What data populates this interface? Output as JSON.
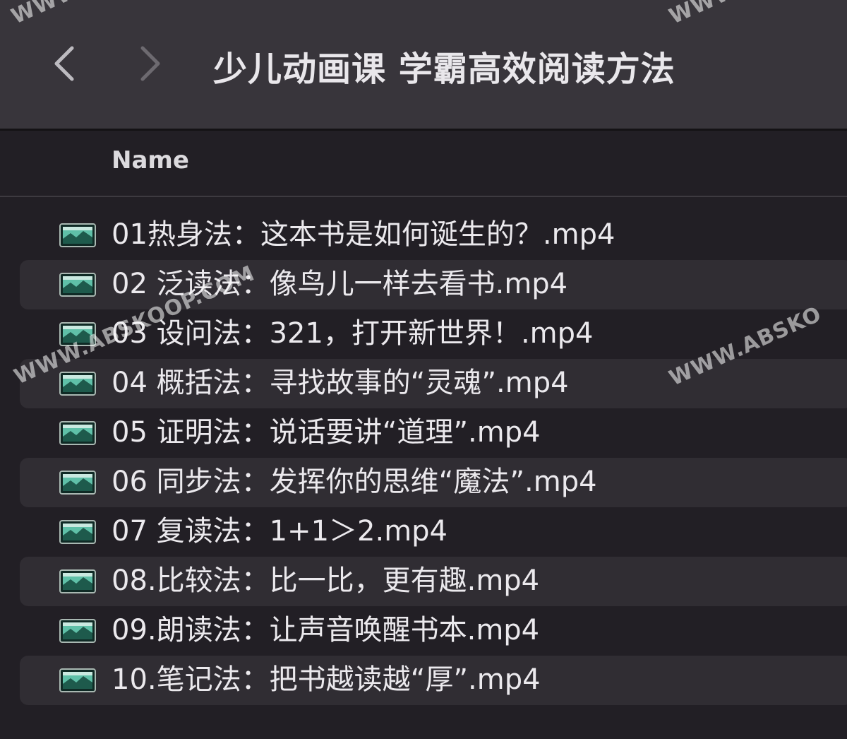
{
  "window": {
    "title": "少儿动画课 学霸高效阅读方法"
  },
  "navigation": {
    "back_icon": "chevron-left-icon",
    "forward_icon": "chevron-right-icon"
  },
  "columns": {
    "name_label": "Name"
  },
  "files": [
    {
      "name": "01热身法：这本书是如何诞生的？.mp4",
      "icon": "video-file-icon"
    },
    {
      "name": "02 泛读法：像鸟儿一样去看书.mp4",
      "icon": "video-file-icon"
    },
    {
      "name": "03 设问法：321，打开新世界！.mp4",
      "icon": "video-file-icon"
    },
    {
      "name": "04 概括法：寻找故事的“灵魂”.mp4",
      "icon": "video-file-icon"
    },
    {
      "name": "05 证明法：说话要讲“道理”.mp4",
      "icon": "video-file-icon"
    },
    {
      "name": "06 同步法：发挥你的思维“魔法”.mp4",
      "icon": "video-file-icon"
    },
    {
      "name": "07 复读法：1+1＞2.mp4",
      "icon": "video-file-icon"
    },
    {
      "name": "08.比较法：比一比，更有趣.mp4",
      "icon": "video-file-icon"
    },
    {
      "name": "09.朗读法：让声音唤醒书本.mp4",
      "icon": "video-file-icon"
    },
    {
      "name": "10.笔记法：把书越读越“厚”.mp4",
      "icon": "video-file-icon"
    }
  ],
  "watermarks": {
    "left": "WWW.ABSKOOP.COM",
    "right": "WWW.ABSKO",
    "top_left": "WWW",
    "top_right": "WWW"
  }
}
